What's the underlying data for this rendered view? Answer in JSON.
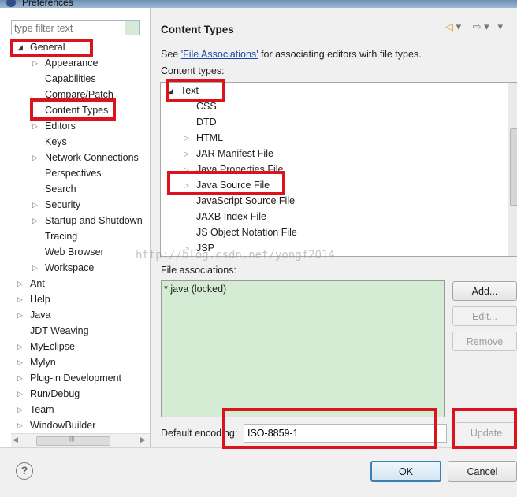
{
  "window": {
    "title": "Preferences"
  },
  "filter": {
    "placeholder": "type filter text"
  },
  "tree": [
    {
      "label": "General",
      "toggle": "◢",
      "level": 0
    },
    {
      "label": "Appearance",
      "toggle": "▷",
      "level": 1
    },
    {
      "label": "Capabilities",
      "toggle": "",
      "level": 1
    },
    {
      "label": "Compare/Patch",
      "toggle": "",
      "level": 1
    },
    {
      "label": "Content Types",
      "toggle": "",
      "level": 1
    },
    {
      "label": "Editors",
      "toggle": "▷",
      "level": 1
    },
    {
      "label": "Keys",
      "toggle": "",
      "level": 1
    },
    {
      "label": "Network Connections",
      "toggle": "▷",
      "level": 1
    },
    {
      "label": "Perspectives",
      "toggle": "",
      "level": 1
    },
    {
      "label": "Search",
      "toggle": "",
      "level": 1
    },
    {
      "label": "Security",
      "toggle": "▷",
      "level": 1
    },
    {
      "label": "Startup and Shutdown",
      "toggle": "▷",
      "level": 1
    },
    {
      "label": "Tracing",
      "toggle": "",
      "level": 1
    },
    {
      "label": "Web Browser",
      "toggle": "",
      "level": 1
    },
    {
      "label": "Workspace",
      "toggle": "▷",
      "level": 1
    },
    {
      "label": "Ant",
      "toggle": "▷",
      "level": 0
    },
    {
      "label": "Help",
      "toggle": "▷",
      "level": 0
    },
    {
      "label": "Java",
      "toggle": "▷",
      "level": 0
    },
    {
      "label": "JDT Weaving",
      "toggle": "",
      "level": 0
    },
    {
      "label": "MyEclipse",
      "toggle": "▷",
      "level": 0
    },
    {
      "label": "Mylyn",
      "toggle": "▷",
      "level": 0
    },
    {
      "label": "Plug-in Development",
      "toggle": "▷",
      "level": 0
    },
    {
      "label": "Run/Debug",
      "toggle": "▷",
      "level": 0
    },
    {
      "label": "Team",
      "toggle": "▷",
      "level": 0
    },
    {
      "label": "WindowBuilder",
      "toggle": "▷",
      "level": 0
    }
  ],
  "page": {
    "title": "Content Types",
    "see_prefix": "See ",
    "see_link": "'File Associations'",
    "see_suffix": " for associating editors with file types.",
    "content_types_label": "Content types:",
    "file_assoc_label": "File associations:",
    "default_encoding_label": "Default encoding:",
    "default_encoding_value": "ISO-8859-1"
  },
  "content_types": [
    {
      "label": "Text",
      "toggle": "◢",
      "level": 0
    },
    {
      "label": "CSS",
      "toggle": "",
      "level": 1
    },
    {
      "label": "DTD",
      "toggle": "",
      "level": 1
    },
    {
      "label": "HTML",
      "toggle": "▷",
      "level": 1
    },
    {
      "label": "JAR Manifest File",
      "toggle": "▷",
      "level": 1
    },
    {
      "label": "Java Properties File",
      "toggle": "▷",
      "level": 1
    },
    {
      "label": "Java Source File",
      "toggle": "▷",
      "level": 1
    },
    {
      "label": "JavaScript Source File",
      "toggle": "",
      "level": 1
    },
    {
      "label": "JAXB Index File",
      "toggle": "",
      "level": 1
    },
    {
      "label": "JS Object Notation File",
      "toggle": "",
      "level": 1
    },
    {
      "label": "JSP",
      "toggle": "▷",
      "level": 1
    }
  ],
  "file_associations": [
    "*.java (locked)"
  ],
  "buttons": {
    "add": "Add...",
    "edit": "Edit...",
    "remove": "Remove",
    "update": "Update",
    "ok": "OK",
    "cancel": "Cancel"
  },
  "icons": {
    "back": "◁",
    "forward": "⇨",
    "menu": "▾",
    "help": "?"
  },
  "watermark": "http://blog.csdn.net/yongf2014",
  "colors": {
    "annotation": "#d9141c",
    "file_assoc_bg": "#d4ecd4",
    "link": "#1a4aa8"
  }
}
